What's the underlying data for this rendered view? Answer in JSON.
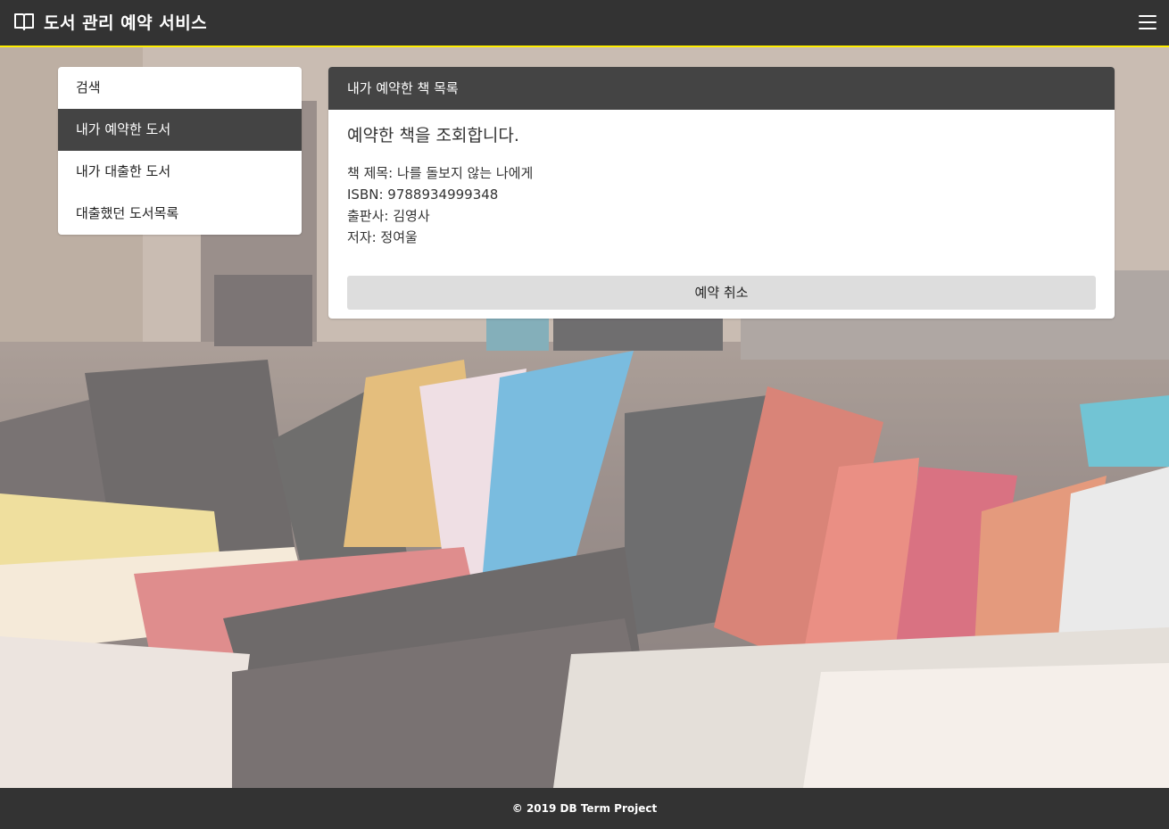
{
  "app": {
    "title": "도서 관리 예약 서비스",
    "brand_icon": "open-book-icon",
    "menu_icon": "hamburger-menu-icon",
    "accent_color": "#ffee00",
    "navbar_color": "#333333"
  },
  "sidebar": {
    "items": [
      {
        "label": "검색",
        "active": false
      },
      {
        "label": "내가 예약한 도서",
        "active": true
      },
      {
        "label": "내가 대출한 도서",
        "active": false
      },
      {
        "label": "대출했던 도서목록",
        "active": false
      }
    ]
  },
  "card": {
    "header": "내가 예약한 책 목록",
    "subtitle": "예약한 책을 조회합니다.",
    "book": {
      "title_line": "책 제목: 나를 돌보지 않는 나에게",
      "isbn_line": "ISBN: 9788934999348",
      "publisher_line": "출판사: 김영사",
      "author_line": "저자: 정여울"
    },
    "cancel_label": "예약 취소"
  },
  "footer": {
    "text": "© 2019 DB Term Project"
  }
}
